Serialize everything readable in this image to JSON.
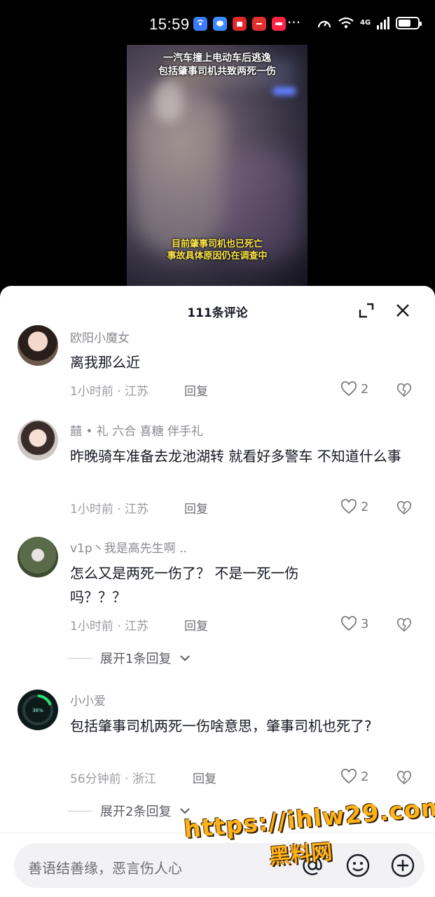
{
  "status_bar": {
    "time": "15:59",
    "app_icons": [
      {
        "name": "wifi-share-icon",
        "color": "#3a7bff"
      },
      {
        "name": "chat-app-icon",
        "color": "#3a8bff"
      },
      {
        "name": "shopping-app-icon",
        "color": "#e0282c"
      },
      {
        "name": "huawei-app-icon",
        "color": "#e03030"
      },
      {
        "name": "xiaohongshu-app-icon",
        "color": "#ff2442"
      }
    ],
    "more": "···",
    "network": "4G"
  },
  "video": {
    "caption_top_line1": "一汽车撞上电动车后逃逸",
    "caption_top_line2": "包括肇事司机共致两死一伤",
    "caption_bottom_line1": "目前肇事司机也已死亡",
    "caption_bottom_line2": "事故具体原因仍在调查中"
  },
  "comments_sheet": {
    "title": "111条评论",
    "comments": [
      {
        "user": "欧阳小魔女",
        "text": "离我那么近",
        "time": "1小时前",
        "location": "江苏",
        "reply_label": "回复",
        "likes": "2"
      },
      {
        "user": "囍 • 礼 六合 喜糖 伴手礼",
        "text": "昨晚骑车准备去龙池湖转 就看好多警车 不知道什么事",
        "time": "1小时前",
        "location": "江苏",
        "reply_label": "回复",
        "likes": "2"
      },
      {
        "user": "v1p丶我是高先生啊 ..",
        "text": "怎么又是两死一伤了？ 不是一死一伤吗？？？",
        "time": "1小时前",
        "location": "江苏",
        "reply_label": "回复",
        "likes": "3",
        "expand_label": "展开1条回复"
      },
      {
        "user": "小小爱",
        "text": "包括肇事司机两死一伤啥意思，肇事司机也死了?",
        "time": "56分钟前",
        "location": "浙江",
        "reply_label": "回复",
        "likes": "2",
        "expand_label": "展开2条回复"
      }
    ],
    "meta_separator": "·"
  },
  "input_bar": {
    "placeholder": "善语结善缘，恶言伤人心"
  },
  "watermark": {
    "url": "https://ihlw29.com",
    "name": "黑料网"
  },
  "colors": {
    "sheet_bg": "#ffffff",
    "text_primary": "#161823",
    "text_secondary": "#8a8b91",
    "caption_yellow": "#ffe84a",
    "watermark": "#ffb21a"
  }
}
